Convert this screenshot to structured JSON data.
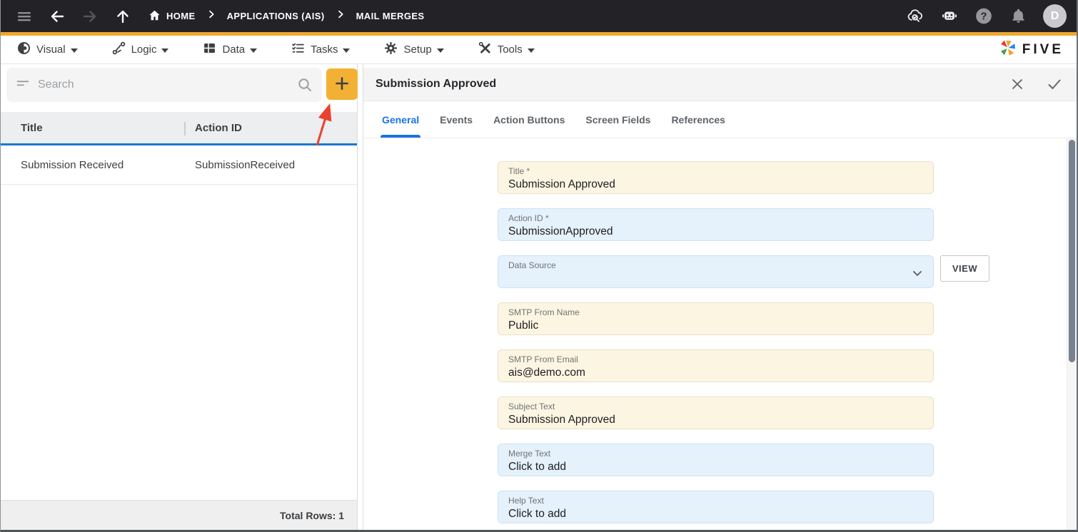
{
  "topbar": {
    "breadcrumbs": [
      {
        "label": "HOME"
      },
      {
        "label": "APPLICATIONS (AIS)"
      },
      {
        "label": "MAIL MERGES"
      }
    ],
    "right_icons": [
      "cloud-search-icon",
      "bot-icon",
      "help-icon",
      "notifications-icon",
      "avatar"
    ],
    "avatar_initial": "D"
  },
  "menubar": {
    "items": [
      {
        "label": "Visual",
        "icon": "eye-icon"
      },
      {
        "label": "Logic",
        "icon": "branch-icon"
      },
      {
        "label": "Data",
        "icon": "table-icon"
      },
      {
        "label": "Tasks",
        "icon": "checklist-icon"
      },
      {
        "label": "Setup",
        "icon": "gear-icon"
      },
      {
        "label": "Tools",
        "icon": "tools-icon"
      }
    ],
    "brand": "FIVE"
  },
  "list_panel": {
    "search_placeholder": "Search",
    "columns": {
      "title": "Title",
      "action_id": "Action ID"
    },
    "rows": [
      {
        "title": "Submission Received",
        "action_id": "SubmissionReceived"
      }
    ],
    "footer": "Total Rows: 1"
  },
  "detail_panel": {
    "title": "Submission Approved",
    "tabs": [
      {
        "label": "General",
        "active": true
      },
      {
        "label": "Events",
        "active": false
      },
      {
        "label": "Action Buttons",
        "active": false
      },
      {
        "label": "Screen Fields",
        "active": false
      },
      {
        "label": "References",
        "active": false
      }
    ],
    "fields": [
      {
        "label": "Title *",
        "value": "Submission Approved",
        "variant": "cream"
      },
      {
        "label": "Action ID *",
        "value": "SubmissionApproved",
        "variant": "blue"
      },
      {
        "label": "Data Source",
        "value": "",
        "variant": "blue",
        "has_dropdown": true
      },
      {
        "label": "SMTP From Name",
        "value": "Public",
        "variant": "cream"
      },
      {
        "label": "SMTP From Email",
        "value": "ais@demo.com",
        "variant": "cream"
      },
      {
        "label": "Subject Text",
        "value": "Submission Approved",
        "variant": "cream"
      },
      {
        "label": "Merge Text",
        "value": "Click to add",
        "variant": "blue"
      },
      {
        "label": "Help Text",
        "value": "Click to add",
        "variant": "blue"
      }
    ],
    "view_button_label": "VIEW"
  },
  "colors": {
    "topbar_bg": "#232327",
    "accent_amber": "#F0A830",
    "add_button_amber": "#F2B134",
    "header_underline_blue": "#1B76D2",
    "tab_active_blue": "#1A73E8",
    "field_cream_bg": "#FCF5E2",
    "field_blue_bg": "#E5F1FB",
    "annotation_arrow_red": "#E8432F",
    "scroll_thumb": "#78818F"
  }
}
